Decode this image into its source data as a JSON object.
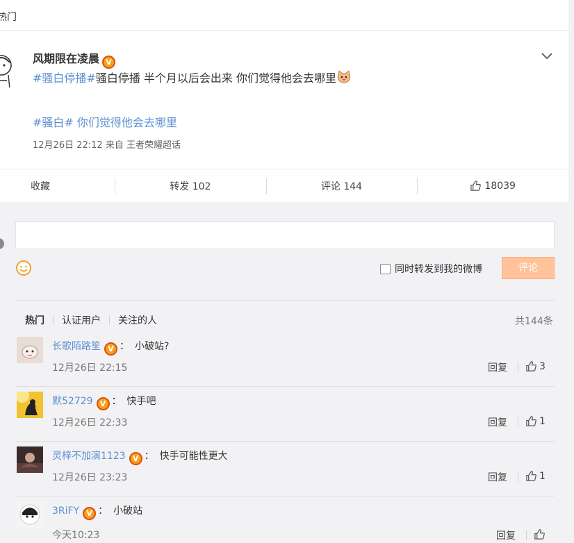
{
  "top_tab": {
    "label": "热门"
  },
  "post": {
    "author": "风期限在凌晨",
    "verified_badge": "V",
    "line1_tag": "#骚白停播#",
    "line1_text": "骚白停播 半个月以后会出来 你们觉得他会去哪里",
    "line1_emoji": "cat-emoji",
    "line2_tag": "#骚白#",
    "line2_text": " 你们觉得他会去哪里",
    "meta": "12月26日 22:12  来自 王者荣耀超话"
  },
  "actions": {
    "favorite": "收藏",
    "repost": "转发 102",
    "comment": "评论 144",
    "likes": "18039"
  },
  "composer": {
    "repost_checkbox_label": "同时转发到我的微博",
    "submit_label": "评论"
  },
  "filters": {
    "hot": "热门",
    "verified": "认证用户",
    "following": "关注的人",
    "total": "共144条"
  },
  "comments": [
    {
      "user": "长歌陌路笙",
      "colon": "：",
      "text": "小破站?",
      "time": "12月26日 22:15",
      "reply": "回复",
      "likes": "3"
    },
    {
      "user": "默52729",
      "colon": "：",
      "text": "快手吧",
      "time": "12月26日 22:33",
      "reply": "回复",
      "likes": "1"
    },
    {
      "user": "灵梓不加演1123",
      "colon": "：",
      "text": "快手可能性更大",
      "time": "12月26日 23:23",
      "reply": "回复",
      "likes": "1"
    },
    {
      "user": "3RiFY",
      "colon": "：",
      "text": "小破站",
      "time": "今天10:23",
      "reply": "回复",
      "likes": ""
    }
  ],
  "colors": {
    "link_blue": "#5c8fd0",
    "badge_orange": "#f5a21b",
    "button_peach": "#ffc29a",
    "background": "#f2f2f5"
  }
}
